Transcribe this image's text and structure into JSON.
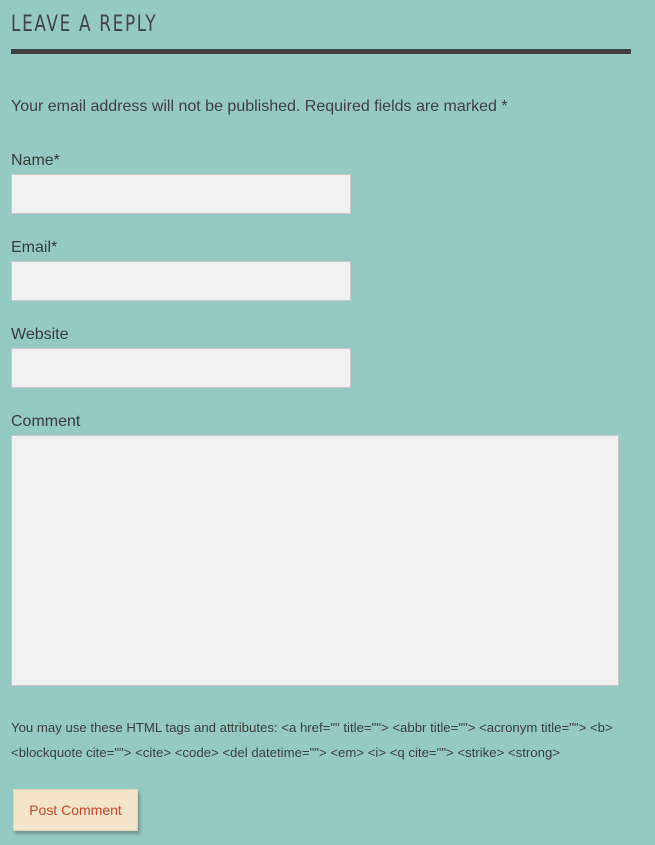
{
  "comment_form": {
    "title": "LEAVE A REPLY",
    "notes": "Your email address will not be published. Required fields are marked *",
    "fields": {
      "name": {
        "label": "Name*",
        "value": "",
        "placeholder": ""
      },
      "email": {
        "label": "Email*",
        "value": "",
        "placeholder": ""
      },
      "website": {
        "label": "Website",
        "value": "",
        "placeholder": ""
      },
      "comment": {
        "label": "Comment",
        "value": "",
        "placeholder": ""
      }
    },
    "allowed_tags": "You may use these HTML tags and attributes: <a href=\"\" title=\"\"> <abbr title=\"\"> <acronym title=\"\"> <b> <blockquote cite=\"\"> <cite> <code> <del datetime=\"\"> <em> <i> <q cite=\"\"> <strike> <strong>",
    "submit_label": "Post Comment"
  },
  "colors": {
    "page_background": "#95cac3",
    "heading_rule": "#404040",
    "input_background": "#f1f1f1",
    "button_background": "#f4e4c9",
    "button_text": "#c9472b"
  }
}
